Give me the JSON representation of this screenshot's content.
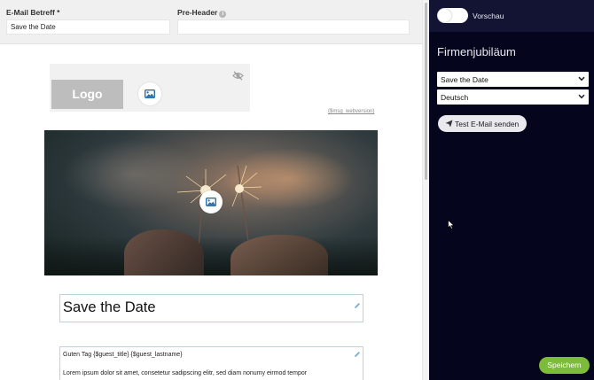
{
  "topbar": {
    "subject_label": "E-Mail Betreff *",
    "subject_value": "Save the Date",
    "preheader_label": "Pre-Header",
    "preheader_value": ""
  },
  "email": {
    "logo_text": "Logo",
    "webversion_link": "{$msg_webversion}",
    "title": "Save the Date",
    "greeting": "Guten Tag {$guest_title} {$guest_lastname}",
    "body_text": "Lorem ipsum dolor sit amet, consetetur sadipscing elitr, sed diam nonumy eirmod tempor"
  },
  "panel": {
    "preview_label": "Vorschau",
    "title": "Firmenjubiläum",
    "template_select": "Save the Date",
    "language_select": "Deutsch",
    "test_button": "Test E-Mail senden",
    "save_button": "Speichern"
  },
  "icons": {
    "info": "info-icon",
    "image": "image-icon",
    "hide": "eye-slash-icon",
    "edit": "pencil-icon",
    "chevron": "chevron-down-icon",
    "send": "paper-plane-icon"
  },
  "colors": {
    "panel_bg": "#05061e",
    "panel_top": "#131433",
    "accent_blue": "#2a6fa8",
    "save_green": "#7dbb3a",
    "block_border": "#b9d4e4"
  }
}
